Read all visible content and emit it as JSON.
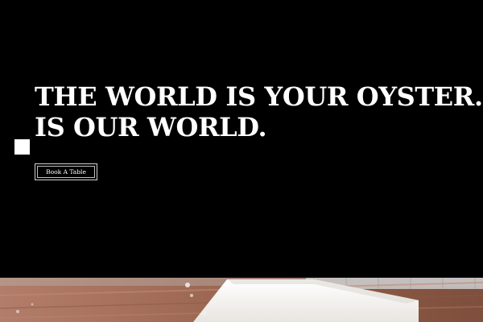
{
  "hero": {
    "headline_line1": "THE WORLD IS YOUR OYSTER. THE",
    "headline_line2": "IS OUR WORLD.",
    "cta_label": "Book A Table",
    "background_color": "#000000",
    "text_color": "#ffffff"
  },
  "photo": {
    "description_icon": "food-photo",
    "table_color": "#9e6b58",
    "plate_color": "#f4f2ee"
  }
}
